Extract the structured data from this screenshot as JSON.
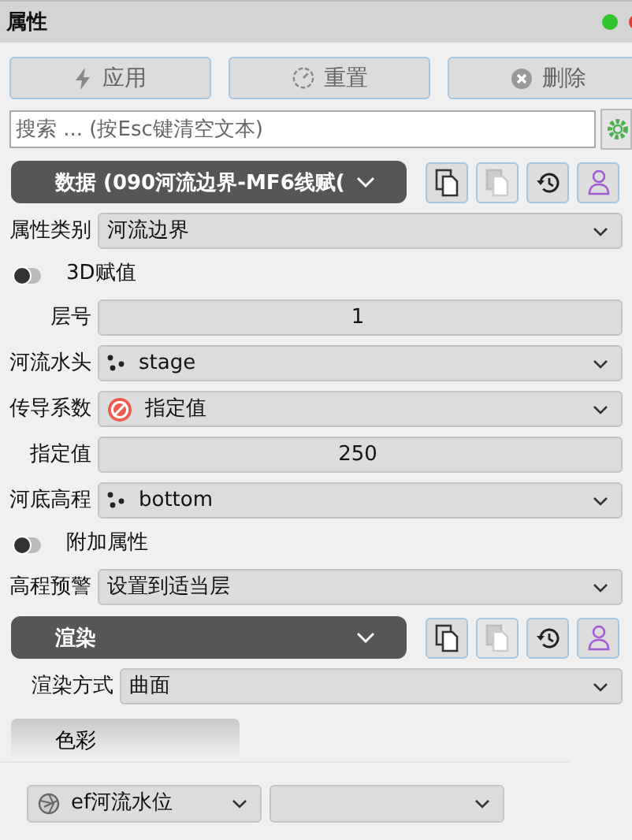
{
  "title": "属性",
  "status_dots": [
    {
      "color": "#2ec52e"
    },
    {
      "color": "#e53935"
    }
  ],
  "actions": [
    {
      "label": "应用"
    },
    {
      "label": "重置"
    },
    {
      "label": "删除"
    }
  ],
  "search": {
    "placeholder": "搜索 ... (按Esc键清空文本)"
  },
  "sections": [
    {
      "title": "数据 (090河流边界-MF6线赋(",
      "tools": [
        {
          "disabled": false
        },
        {
          "disabled": true
        },
        {
          "disabled": false
        },
        {
          "disabled": false
        }
      ],
      "rows": [
        {
          "kind": "select",
          "label": "属性类别",
          "value": "河流边界"
        },
        {
          "kind": "toggle",
          "label": "3D赋值",
          "on": false
        },
        {
          "kind": "number",
          "label": "层号",
          "value": "1"
        },
        {
          "kind": "pointselect",
          "label": "河流水头",
          "value": "stage"
        },
        {
          "kind": "constselect",
          "label": "传导系数",
          "value": "指定值"
        },
        {
          "kind": "number",
          "label": "指定值",
          "value": "250"
        },
        {
          "kind": "pointselect",
          "label": "河底高程",
          "value": "bottom"
        },
        {
          "kind": "toggle",
          "label": "附加属性",
          "on": false
        },
        {
          "kind": "select",
          "label": "高程预警",
          "value": "设置到适当层"
        }
      ]
    },
    {
      "title": "渲染",
      "tools": [
        {
          "disabled": false
        },
        {
          "disabled": true
        },
        {
          "disabled": false
        },
        {
          "disabled": false
        }
      ],
      "rows": [
        {
          "kind": "select",
          "label": "渲染方式",
          "value": "曲面"
        }
      ],
      "tabs": [
        {
          "label": "色彩",
          "selected": true
        }
      ],
      "pickers": [
        {
          "value": "ef河流水位"
        },
        {
          "kind": "empty"
        }
      ]
    }
  ]
}
